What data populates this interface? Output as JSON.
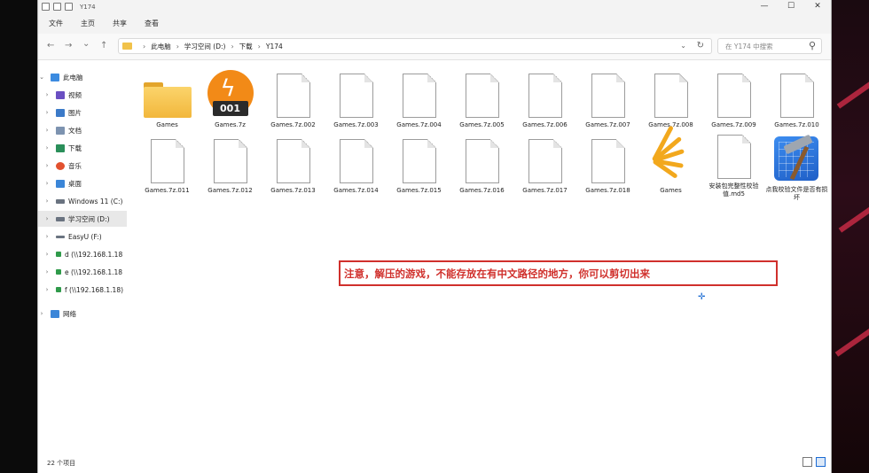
{
  "titlebar": {
    "title": "Y174",
    "minimize": "—",
    "maximize": "☐",
    "close": "✕"
  },
  "menu": {
    "file": "文件",
    "home": "主页",
    "share": "共享",
    "view": "查看"
  },
  "nav": {
    "back": "←",
    "forward": "→",
    "recent": "⌄",
    "up": "↑",
    "breadcrumb": [
      "此电脑",
      "学习空间 (D:)",
      "下载",
      "Y174"
    ],
    "search_placeholder": "在 Y174 中搜索"
  },
  "sidebar": {
    "items": [
      {
        "label": "此电脑",
        "icon": "computer-icon",
        "color": "#3c8be0"
      },
      {
        "label": "视频",
        "icon": "video-icon",
        "color": "#6a4fc2"
      },
      {
        "label": "图片",
        "icon": "picture-icon",
        "color": "#3b7ac8"
      },
      {
        "label": "文档",
        "icon": "document-icon",
        "color": "#7d93b0"
      },
      {
        "label": "下载",
        "icon": "download-icon",
        "color": "#2a8f5a"
      },
      {
        "label": "音乐",
        "icon": "music-icon",
        "color": "#e2512f"
      },
      {
        "label": "桌面",
        "icon": "desktop-icon",
        "color": "#3b86d8"
      },
      {
        "label": "Windows 11 (C:)",
        "icon": "drive-icon",
        "color": "#6a7380"
      },
      {
        "label": "学习空间 (D:)",
        "icon": "drive-icon",
        "color": "#6a7380"
      },
      {
        "label": "EasyU (F:)",
        "icon": "usb-drive-icon",
        "color": "#6a7380"
      },
      {
        "label": "d (\\\\192.168.1.18",
        "icon": "network-drive-icon",
        "color": "#2f9a4a"
      },
      {
        "label": "e (\\\\192.168.1.18",
        "icon": "network-drive-icon",
        "color": "#2f9a4a"
      },
      {
        "label": "f (\\\\192.168.1.18)",
        "icon": "network-drive-icon",
        "color": "#2f9a4a"
      },
      {
        "label": "网络",
        "icon": "network-icon",
        "color": "#3b86d8"
      }
    ]
  },
  "files": [
    {
      "label": "Games",
      "icon": "folder-icon"
    },
    {
      "label": "Games.7z",
      "icon": "archive-icon",
      "badge": "001"
    },
    {
      "label": "Games.7z.002",
      "icon": "blank-file-icon"
    },
    {
      "label": "Games.7z.003",
      "icon": "blank-file-icon"
    },
    {
      "label": "Games.7z.004",
      "icon": "blank-file-icon"
    },
    {
      "label": "Games.7z.005",
      "icon": "blank-file-icon"
    },
    {
      "label": "Games.7z.006",
      "icon": "blank-file-icon"
    },
    {
      "label": "Games.7z.007",
      "icon": "blank-file-icon"
    },
    {
      "label": "Games.7z.008",
      "icon": "blank-file-icon"
    },
    {
      "label": "Games.7z.009",
      "icon": "blank-file-icon"
    },
    {
      "label": "Games.7z.010",
      "icon": "blank-file-icon"
    },
    {
      "label": "Games.7z.011",
      "icon": "blank-file-icon"
    },
    {
      "label": "Games.7z.012",
      "icon": "blank-file-icon"
    },
    {
      "label": "Games.7z.013",
      "icon": "blank-file-icon"
    },
    {
      "label": "Games.7z.014",
      "icon": "blank-file-icon"
    },
    {
      "label": "Games.7z.015",
      "icon": "blank-file-icon"
    },
    {
      "label": "Games.7z.016",
      "icon": "blank-file-icon"
    },
    {
      "label": "Games.7z.017",
      "icon": "blank-file-icon"
    },
    {
      "label": "Games.7z.018",
      "icon": "blank-file-icon"
    },
    {
      "label": "Games",
      "icon": "game-shortcut-icon"
    },
    {
      "label": "安装包完整性校验值.md5",
      "icon": "blank-file-icon"
    },
    {
      "label": "点我校验文件是否有损坏",
      "icon": "hammer-tool-icon"
    }
  ],
  "notice": {
    "text": "注意，解压的游戏，不能存放在有中文路径的地方，你可以剪切出来"
  },
  "status": {
    "count": "22 个项目"
  },
  "colors": {
    "notice_red": "#d0302c",
    "accent_blue": "#1b6bd3",
    "folder_yellow": "#f2b73c",
    "archive_orange": "#f28a17"
  }
}
